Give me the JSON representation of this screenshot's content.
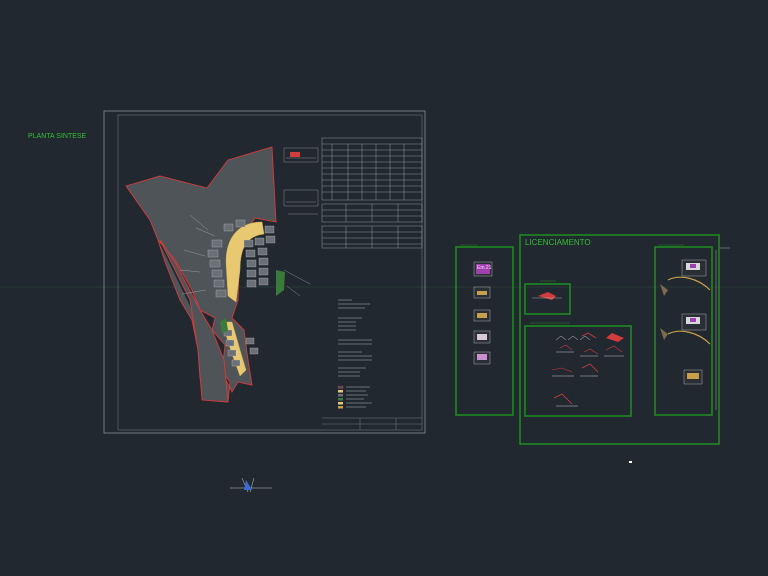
{
  "drawing": {
    "title_planta": "PLANTA SINTESE",
    "title_licenciamento": "LICENCIAMENTO",
    "thumb_badge": "Em.21"
  },
  "colors": {
    "background": "#212830",
    "green_frame": "#1f8a1f",
    "green_text": "#34c034",
    "site_red": "#d23c3c",
    "road_yellow": "#e8c870",
    "site_fill": "#4f5459",
    "sheet_line": "#8a8f96"
  }
}
